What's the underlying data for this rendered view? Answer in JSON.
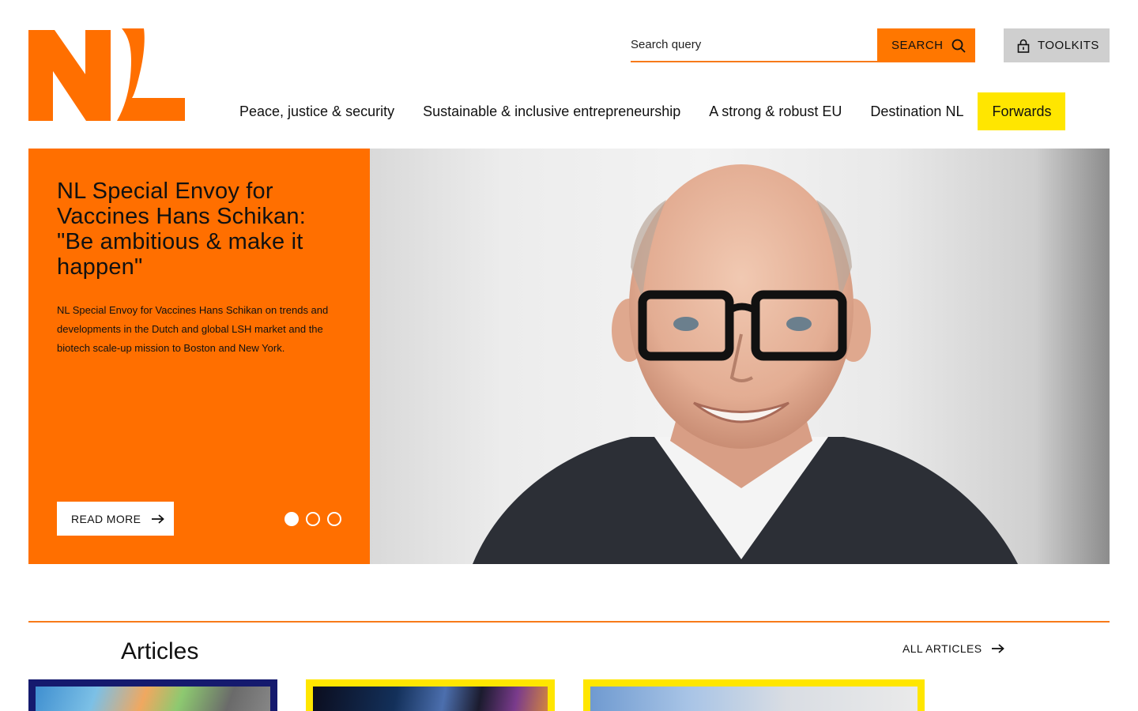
{
  "brand": {
    "logo_text": "NL",
    "accent": "#ff6f00",
    "highlight": "#ffe600"
  },
  "header": {
    "search_placeholder": "Search query",
    "search_button": "SEARCH",
    "toolkits_button": "TOOLKITS"
  },
  "nav": {
    "items": [
      {
        "label": "Peace, justice & security"
      },
      {
        "label": "Sustainable & inclusive entrepreneurship"
      },
      {
        "label": "A strong & robust EU"
      },
      {
        "label": "Destination NL"
      },
      {
        "label": "Forwards",
        "active": true
      }
    ]
  },
  "hero": {
    "title": "NL Special Envoy for Vaccines Hans Schikan: \"Be ambitious & make it happen\"",
    "description": "NL Special Envoy for Vaccines Hans Schikan on trends and developments in the Dutch and global LSH market and the biotech scale-up mission to Boston and New York.",
    "read_more": "READ MORE",
    "slides_total": 3,
    "active_slide": 1,
    "image_subject": "portrait-photo"
  },
  "articles": {
    "title": "Articles",
    "all_link": "ALL ARTICLES"
  }
}
